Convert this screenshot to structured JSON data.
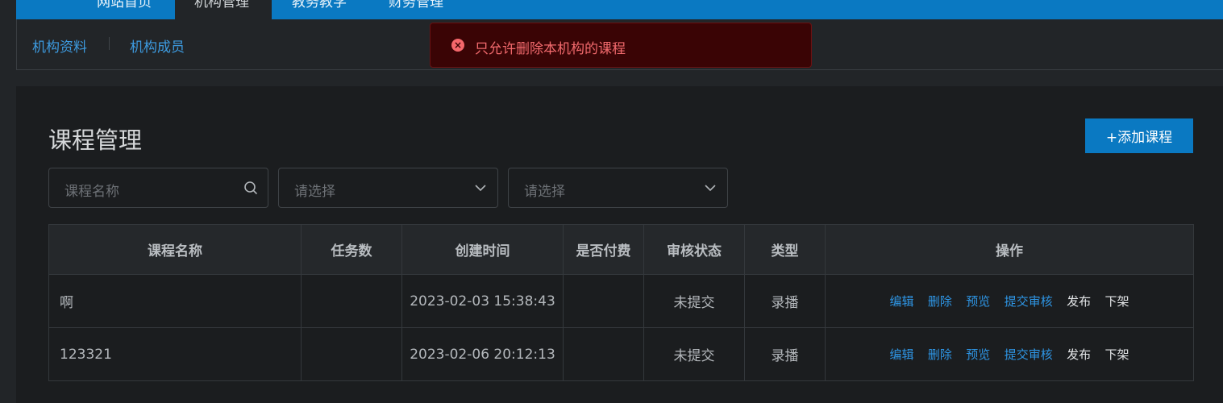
{
  "topnav": {
    "tabs": [
      {
        "label": "网站首页"
      },
      {
        "label": "机构管理",
        "active": true
      },
      {
        "label": "教务教学"
      },
      {
        "label": "财务管理"
      }
    ]
  },
  "subnav": {
    "items": [
      {
        "label": "机构资料"
      },
      {
        "label": "机构成员"
      }
    ]
  },
  "toast": {
    "message": "只允许删除本机构的课程",
    "type": "error",
    "icon": "error-circle-icon"
  },
  "main": {
    "title": "课程管理",
    "add_button": "+添加课程",
    "filters": {
      "name_placeholder": "课程名称",
      "select1_placeholder": "请选择",
      "select2_placeholder": "请选择"
    },
    "table": {
      "columns": [
        "课程名称",
        "任务数",
        "创建时间",
        "是否付费",
        "审核状态",
        "类型",
        "操作"
      ],
      "rows": [
        {
          "name": "啊",
          "tasks": "",
          "created": "2023-02-03 15:38:43",
          "paid": "",
          "status": "未提交",
          "type": "录播"
        },
        {
          "name": "123321",
          "tasks": "",
          "created": "2023-02-06 20:12:13",
          "paid": "",
          "status": "未提交",
          "type": "录播"
        }
      ],
      "actions": {
        "edit": "编辑",
        "delete": "删除",
        "preview": "预览",
        "submit": "提交审核",
        "publish": "发布",
        "unpublish": "下架"
      }
    }
  },
  "colors": {
    "accent": "#0a79c2",
    "link": "#2e95e4",
    "error_bg": "#3a0405",
    "error_text": "#f26a6d"
  }
}
